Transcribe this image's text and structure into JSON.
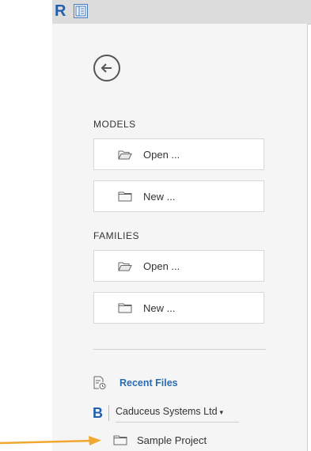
{
  "titlebar": {
    "app_logo": "R",
    "icons": [
      "app-logo-icon",
      "panel-toggle-icon"
    ]
  },
  "back_button": {
    "icon": "back-arrow-icon"
  },
  "models": {
    "label": "MODELS",
    "items": [
      {
        "label": "Open ...",
        "icon": "folder-open-icon"
      },
      {
        "label": "New ...",
        "icon": "folder-new-icon"
      }
    ]
  },
  "families": {
    "label": "FAMILIES",
    "items": [
      {
        "label": "Open ...",
        "icon": "folder-open-icon"
      },
      {
        "label": "New ...",
        "icon": "folder-new-icon"
      }
    ]
  },
  "recent": {
    "label": "Recent Files",
    "icon": "recent-files-icon"
  },
  "account": {
    "logo": "B",
    "org_name": "Caduceus Systems Ltd",
    "caret": "▾"
  },
  "projects": [
    {
      "label": "Sample Project",
      "icon": "folder-icon"
    }
  ],
  "colors": {
    "accent": "#2b6cb0",
    "logo": "#1f5fae",
    "arrow": "#f0a830",
    "panel_bg": "#f5f5f5",
    "titlebar_bg": "#dcdcdc"
  }
}
